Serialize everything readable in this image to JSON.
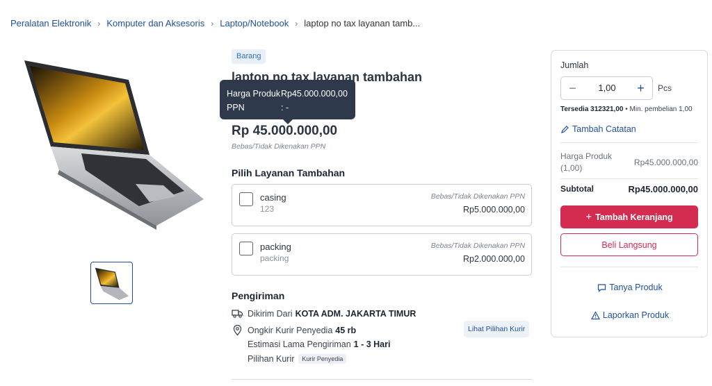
{
  "breadcrumb": {
    "items": [
      "Peralatan Elektronik",
      "Komputer dan Aksesoris",
      "Laptop/Notebook"
    ],
    "current": "laptop no tax layanan tamb..."
  },
  "product": {
    "type_badge": "Barang",
    "title": "laptop no tax layanan tambahan",
    "price": "Rp 45.000.000,00",
    "price_note": "Bebas/Tidak Dikenakan PPN"
  },
  "tooltip": {
    "harga_label": "Harga Produk :",
    "harga_value": "Rp45.000.000,00",
    "ppn_label": "PPN",
    "ppn_value": ": -"
  },
  "services": {
    "title": "Pilih Layanan Tambahan",
    "items": [
      {
        "name": "casing",
        "desc": "123",
        "tax": "Bebas/Tidak Dikenakan PPN",
        "amount": "Rp5.000.000,00"
      },
      {
        "name": "packing",
        "desc": "packing",
        "tax": "Bebas/Tidak Dikenakan PPN",
        "amount": "Rp2.000.000,00"
      }
    ]
  },
  "shipping": {
    "title": "Pengiriman",
    "from_label": "Dikirim Dari",
    "from_value": "KOTA ADM. JAKARTA TIMUR",
    "cost_label": "Ongkir Kurir Penyedia",
    "cost_value": "45 rb",
    "eta_label": "Estimasi Lama Pengiriman",
    "eta_value": "1 - 3 Hari",
    "courier_label": "Pilihan Kurir",
    "courier_chip": "Kurir Penyedia",
    "see_courier_button": "Lihat Pilihan Kurir"
  },
  "order": {
    "qty_label": "Jumlah",
    "minus": "−",
    "qty_value": "1,00",
    "plus": "+",
    "unit": "Pcs",
    "stock_label": "Tersedia 312321,00",
    "min_purchase": " • Min. pembelian 1,00",
    "add_note": "Tambah Catatan",
    "price_label": "Harga Produk (1,00)",
    "price_value": "Rp45.000.000,00",
    "subtotal_label": "Subtotal",
    "subtotal_value": "Rp45.000.000,00",
    "add_cart_button": "Tambah Keranjang",
    "buy_now_button": "Beli Langsung",
    "ask_product": "Tanya Produk",
    "report_product": "Laporkan Produk"
  },
  "colors": {
    "accent": "#d42b51",
    "link": "#1f4f9e",
    "tooltip_bg": "#2e3a4b"
  }
}
